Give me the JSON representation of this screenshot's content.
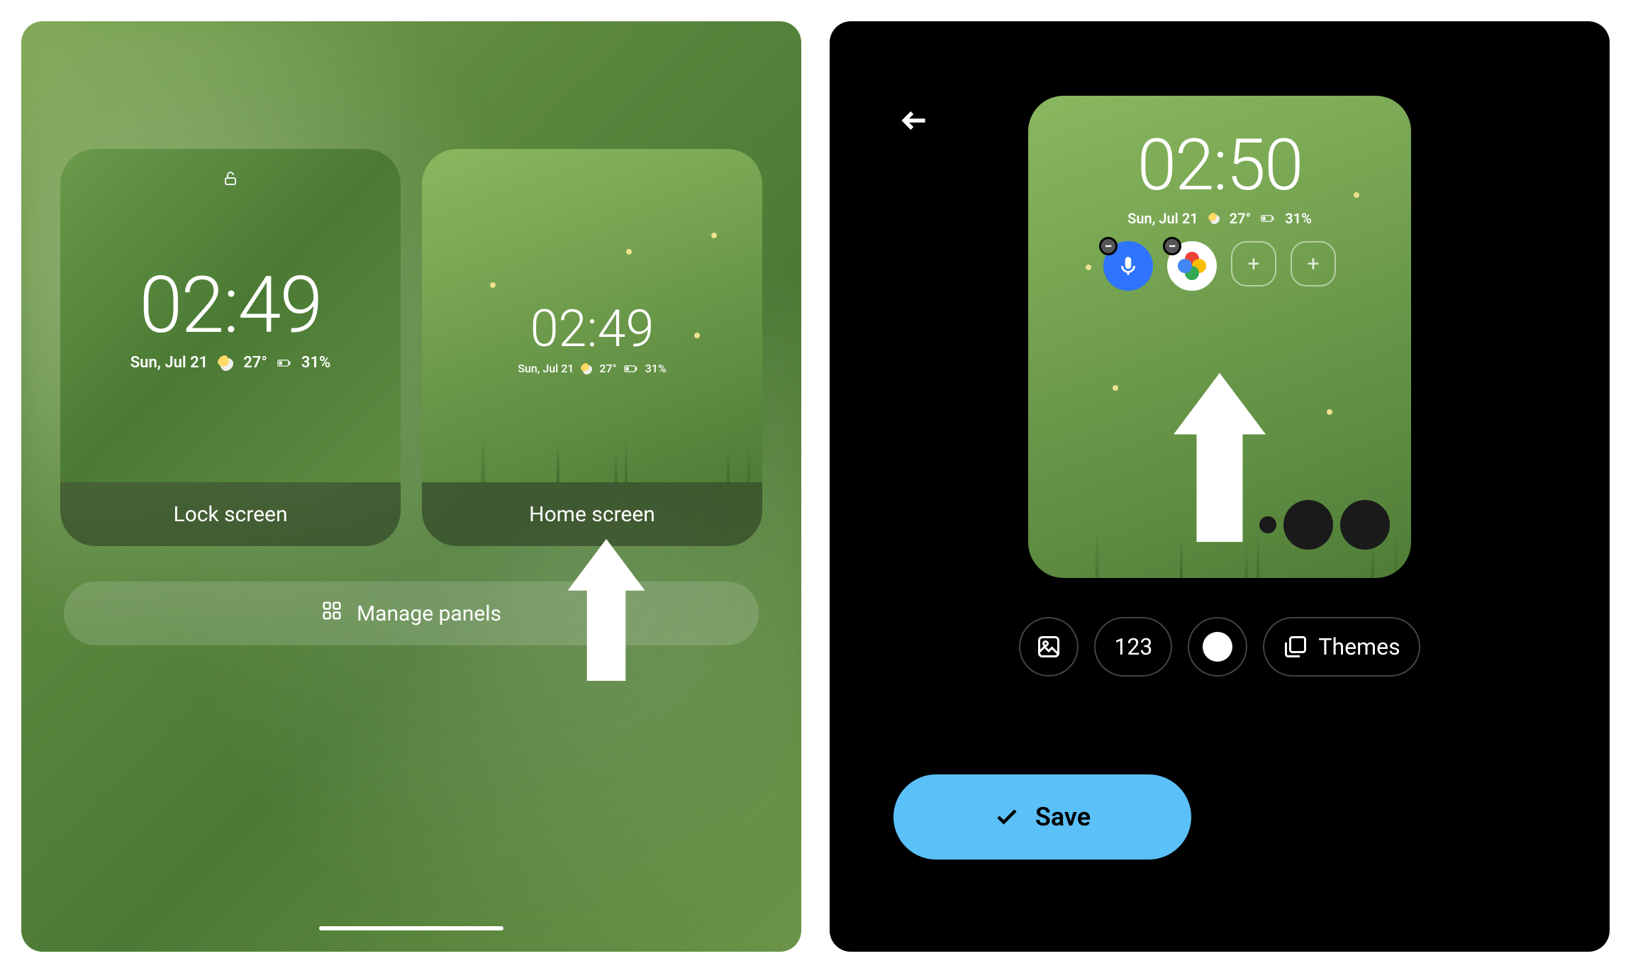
{
  "left": {
    "lock_card": {
      "label": "Lock screen",
      "time": "02:49",
      "date": "Sun, Jul 21",
      "temp": "27°",
      "battery": "31%"
    },
    "home_card": {
      "label": "Home screen",
      "time": "02:49",
      "date": "Sun, Jul 21",
      "temp": "27°",
      "battery": "31%"
    },
    "manage_panels": "Manage panels"
  },
  "right": {
    "preview": {
      "time": "02:50",
      "date": "Sun, Jul 21",
      "temp": "27°",
      "battery": "31%"
    },
    "controls": {
      "clock_style": "123",
      "themes": "Themes"
    },
    "save": "Save"
  },
  "icons": {
    "unlock": "unlock-icon",
    "weather": "weather-icon",
    "battery": "battery-icon",
    "grid": "grid-icon",
    "back": "back-arrow-icon",
    "image": "image-icon",
    "layers": "layers-icon",
    "check": "check-icon",
    "plus": "plus-icon",
    "minus": "minus-icon",
    "mic": "mic-icon",
    "photos": "photos-icon"
  },
  "colors": {
    "accent_blue": "#5bc0f8",
    "bg_green_a": "#7fa855",
    "bg_green_b": "#4c7a35"
  }
}
